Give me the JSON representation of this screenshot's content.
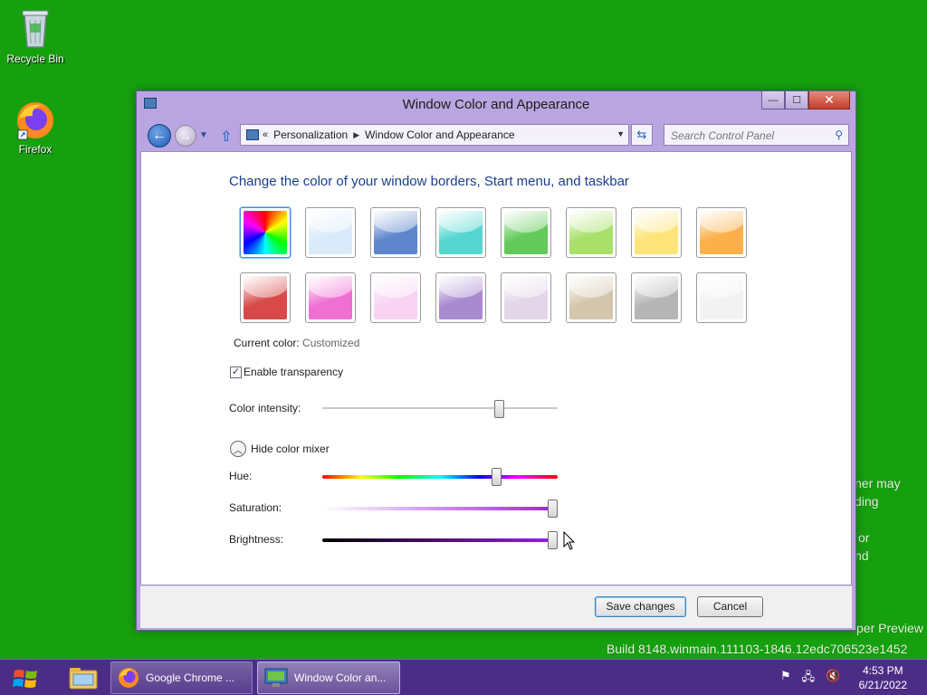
{
  "desktop": {
    "icons": [
      {
        "label": "Recycle Bin",
        "icon": "recycle-bin-icon"
      },
      {
        "label": "Firefox",
        "icon": "firefox-icon"
      }
    ],
    "watermark": {
      "partial_lines": [
        "ner may",
        "ding",
        "or",
        "nd"
      ],
      "edition": "per Preview",
      "build": "Build 8148.winmain.111103-1846.12edc706523e1452"
    }
  },
  "window": {
    "title": "Window Color and Appearance",
    "controls": {
      "minimize": "—",
      "maximize": "☐",
      "close": "✕"
    },
    "address": {
      "overflow": "«",
      "crumbs": [
        "Personalization",
        "Window Color and Appearance"
      ]
    },
    "search": {
      "placeholder": "Search Control Panel"
    },
    "heading": "Change the color of your window borders, Start menu, and taskbar",
    "swatches": [
      {
        "name": "rainbow",
        "color": "#ff0000"
      },
      {
        "name": "sky",
        "color": "#d9ebfb"
      },
      {
        "name": "twilight",
        "color": "#5d86cc"
      },
      {
        "name": "sea-foam",
        "color": "#55d6d0"
      },
      {
        "name": "leaf",
        "color": "#63c95a"
      },
      {
        "name": "lime",
        "color": "#a8e06a"
      },
      {
        "name": "lemon",
        "color": "#fde47a"
      },
      {
        "name": "pumpkin",
        "color": "#fcb04a"
      },
      {
        "name": "ruby",
        "color": "#d84a4a"
      },
      {
        "name": "fuchsia",
        "color": "#f06fd2"
      },
      {
        "name": "blush",
        "color": "#f8d4f2"
      },
      {
        "name": "violet",
        "color": "#a88ad0"
      },
      {
        "name": "lavender",
        "color": "#e2d6e8"
      },
      {
        "name": "taupe",
        "color": "#d4c6ac"
      },
      {
        "name": "chocolate",
        "color": "#b5b5b5"
      },
      {
        "name": "frost",
        "color": "#f2f2f2"
      }
    ],
    "current_color_label": "Current color:",
    "current_color_value": "Customized",
    "transparency": {
      "label": "Enable transparency",
      "checked": true,
      "check_glyph": "✓"
    },
    "intensity": {
      "label": "Color intensity:",
      "value": 0.75
    },
    "mixer_toggle": {
      "label": "Hide color mixer",
      "glyph": "︿"
    },
    "hue": {
      "label": "Hue:",
      "value": 0.74
    },
    "saturation": {
      "label": "Saturation:",
      "value": 0.98
    },
    "brightness": {
      "label": "Brightness:",
      "value": 0.98
    },
    "buttons": {
      "save": "Save changes",
      "cancel": "Cancel"
    }
  },
  "taskbar": {
    "items": [
      {
        "label": "Google Chrome ...",
        "icon": "firefox-icon"
      },
      {
        "label": "Window Color an...",
        "icon": "control-panel-icon"
      }
    ],
    "clock": {
      "time": "4:53 PM",
      "date": "6/21/2022"
    }
  },
  "colors": {
    "desktop": "#16a00e",
    "window_frame": "#b9a6e0",
    "taskbar": "#4b2d86",
    "heading": "#1a3e8c"
  }
}
